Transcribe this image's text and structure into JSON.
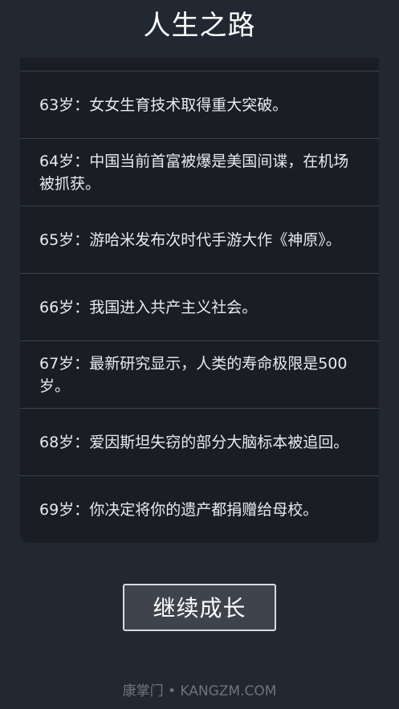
{
  "header": {
    "title": "人生之路"
  },
  "events": [
    {
      "age": "63岁：",
      "text": "女女生育技术取得重大突破。"
    },
    {
      "age": "64岁：",
      "text": "中国当前首富被爆是美国间谍，在机场被抓获。"
    },
    {
      "age": "65岁：",
      "text": "游哈米发布次时代手游大作《神原》。"
    },
    {
      "age": "66岁：",
      "text": "我国进入共产主义社会。"
    },
    {
      "age": "67岁：",
      "text": "最新研究显示，人类的寿命极限是500岁。"
    },
    {
      "age": "68岁：",
      "text": "爱因斯坦失窃的部分大脑标本被追回。"
    },
    {
      "age": "69岁：",
      "text": "你决定将你的遗产都捐赠给母校。"
    }
  ],
  "actions": {
    "continue_label": "继续成长"
  },
  "footer": {
    "watermark": "康掌门 • KANGZM.COM"
  }
}
